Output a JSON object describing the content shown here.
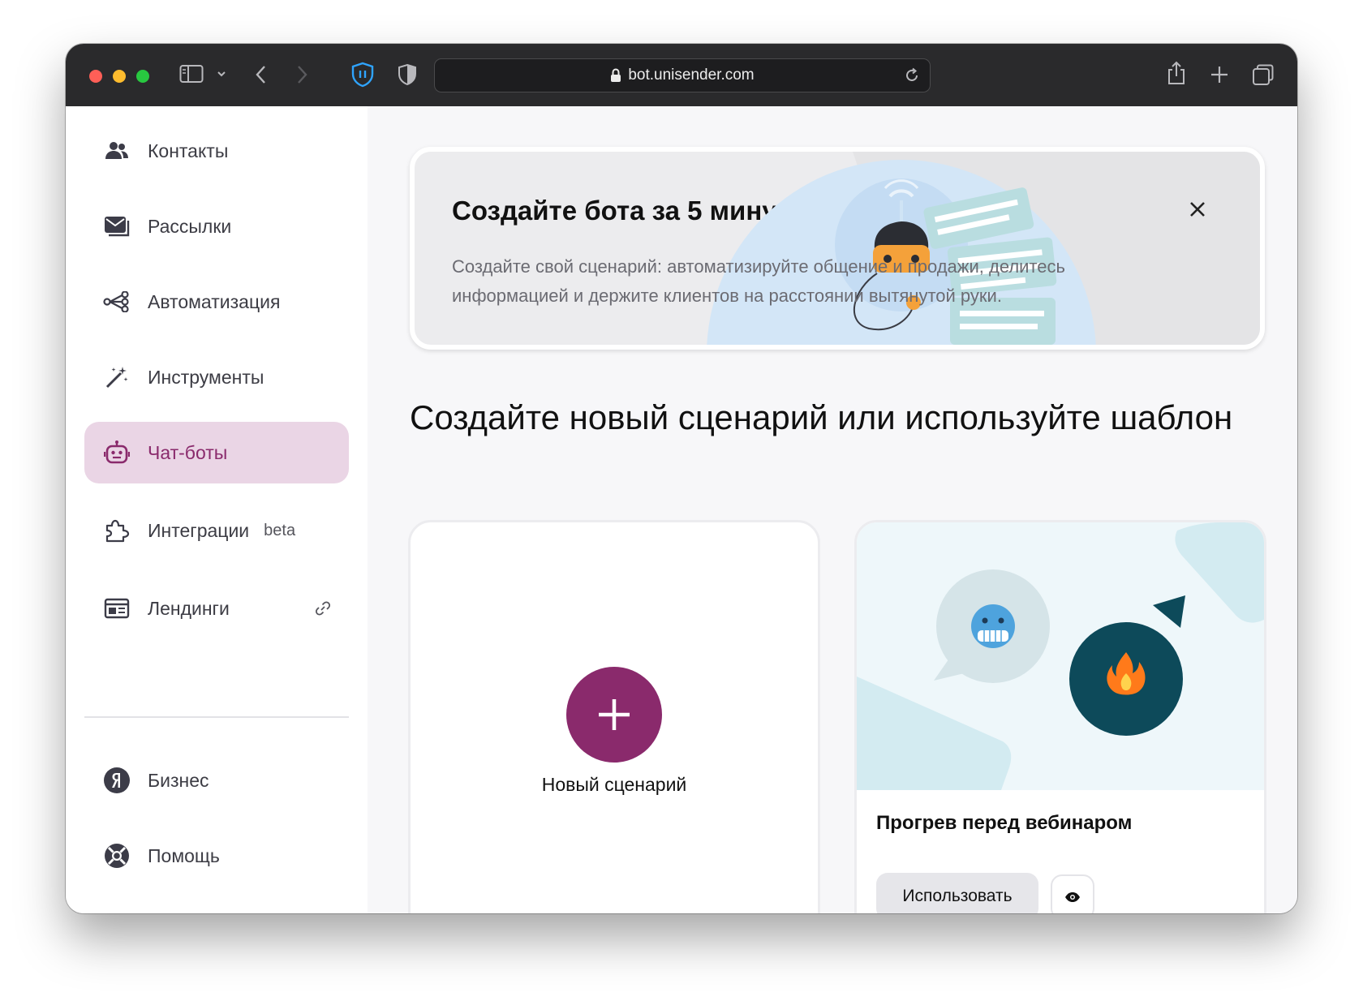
{
  "browser": {
    "url": "bot.unisender.com"
  },
  "sidebar": {
    "items": [
      {
        "label": "Контакты",
        "icon": "contacts-icon"
      },
      {
        "label": "Рассылки",
        "icon": "mail-icon"
      },
      {
        "label": "Автоматизация",
        "icon": "automation-icon"
      },
      {
        "label": "Инструменты",
        "icon": "magic-wand-icon"
      },
      {
        "label": "Чат-боты",
        "icon": "robot-icon",
        "active": true
      },
      {
        "label": "Интеграции",
        "badge": "beta",
        "icon": "puzzle-icon"
      },
      {
        "label": "Лендинги",
        "icon": "landing-icon",
        "trailing_icon": "link-icon"
      }
    ],
    "footer_items": [
      {
        "label": "Бизнес",
        "icon": "yandex-icon"
      },
      {
        "label": "Помощь",
        "icon": "lifebuoy-icon"
      }
    ]
  },
  "banner": {
    "title": "Создайте бота за 5 минут",
    "text": "Создайте свой сценарий: автоматизируйте общение и продажи, делитесь информацией и держите клиентов на расстоянии вытянутой руки."
  },
  "main": {
    "section_title": "Создайте новый сценарий или используйте шаблон",
    "new_card_label": "Новый сценарий",
    "template": {
      "title": "Прогрев перед вебинаром",
      "use_label": "Использовать"
    }
  },
  "colors": {
    "accent": "#8a2a6c",
    "active_bg": "#ead5e5",
    "toolbar": "#2a2a2c"
  }
}
